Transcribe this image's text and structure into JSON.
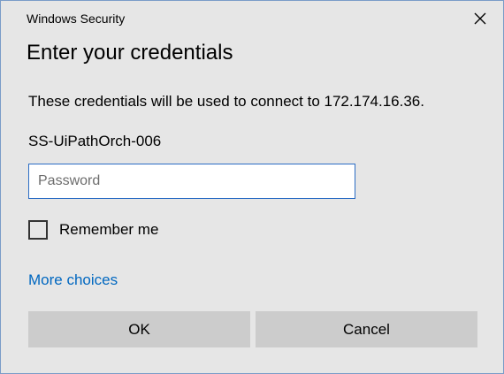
{
  "window": {
    "title": "Windows Security",
    "close_icon": "close-icon"
  },
  "dialog": {
    "heading": "Enter your credentials",
    "message": "These credentials will be used to connect to 172.174.16.36.",
    "username": "SS-UiPathOrch-006"
  },
  "password_field": {
    "value": "",
    "placeholder": "Password"
  },
  "remember": {
    "label": "Remember me",
    "checked": false
  },
  "more_choices_label": "More choices",
  "buttons": {
    "ok_label": "OK",
    "cancel_label": "Cancel"
  },
  "colors": {
    "background": "#e6e6e6",
    "link": "#0067c0",
    "input_border": "#2b6cc4",
    "button": "#cccccc"
  }
}
